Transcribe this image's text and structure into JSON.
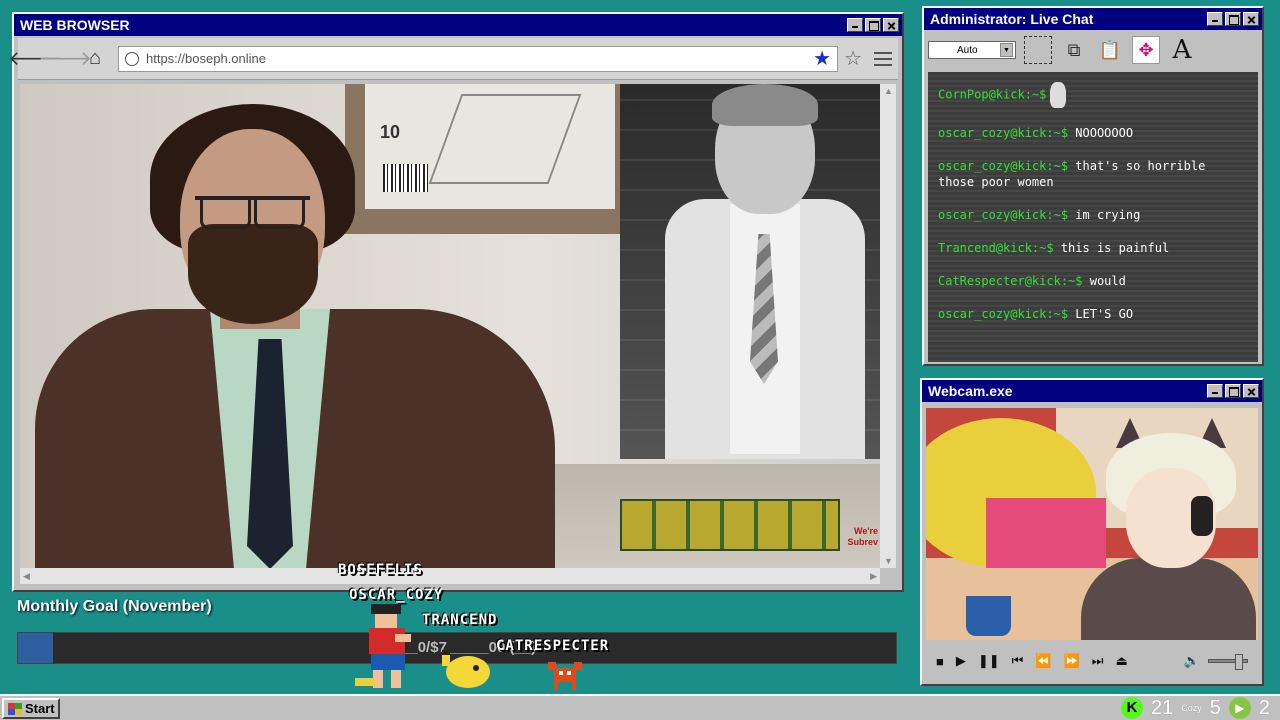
{
  "browser": {
    "title": "WEB BROWSER",
    "url": "https://boseph.online",
    "poster_number": "10",
    "sign_text_1": "We're",
    "sign_text_2": "Subrev"
  },
  "goal": {
    "label": "Monthly Goal (November)",
    "progress_text": "$3___0/$7_____00 (__)",
    "progress_fraction": 0.04
  },
  "usernames": [
    "BOSEFELIS",
    "OSCAR_COZY",
    "TRANCEND",
    "CATRESPECTER"
  ],
  "chat": {
    "title": "Administrator: Live Chat",
    "dropdown_value": "Auto",
    "messages": [
      {
        "user": "CornPop@kick:~$",
        "text": ""
      },
      {
        "user": "oscar_cozy@kick:~$",
        "text": "NOOOOOOO"
      },
      {
        "user": "oscar_cozy@kick:~$",
        "text": "that's so horrible those poor women"
      },
      {
        "user": "oscar_cozy@kick:~$",
        "text": "im crying"
      },
      {
        "user": "Trancend@kick:~$",
        "text": "this is painful"
      },
      {
        "user": "CatRespecter@kick:~$",
        "text": "would"
      },
      {
        "user": "oscar_cozy@kick:~$",
        "text": "LET'S GO"
      }
    ]
  },
  "webcam": {
    "title": "Webcam.exe"
  },
  "taskbar": {
    "start_label": "Start",
    "kick_count": "21",
    "cozy_label": "Cozy",
    "cozy_count": "5",
    "rumble_count": "2"
  },
  "colors": {
    "desktop": "#1a8f8a",
    "titlebar": "#000080",
    "chat_user": "#33e033",
    "kick": "#53fc18"
  }
}
